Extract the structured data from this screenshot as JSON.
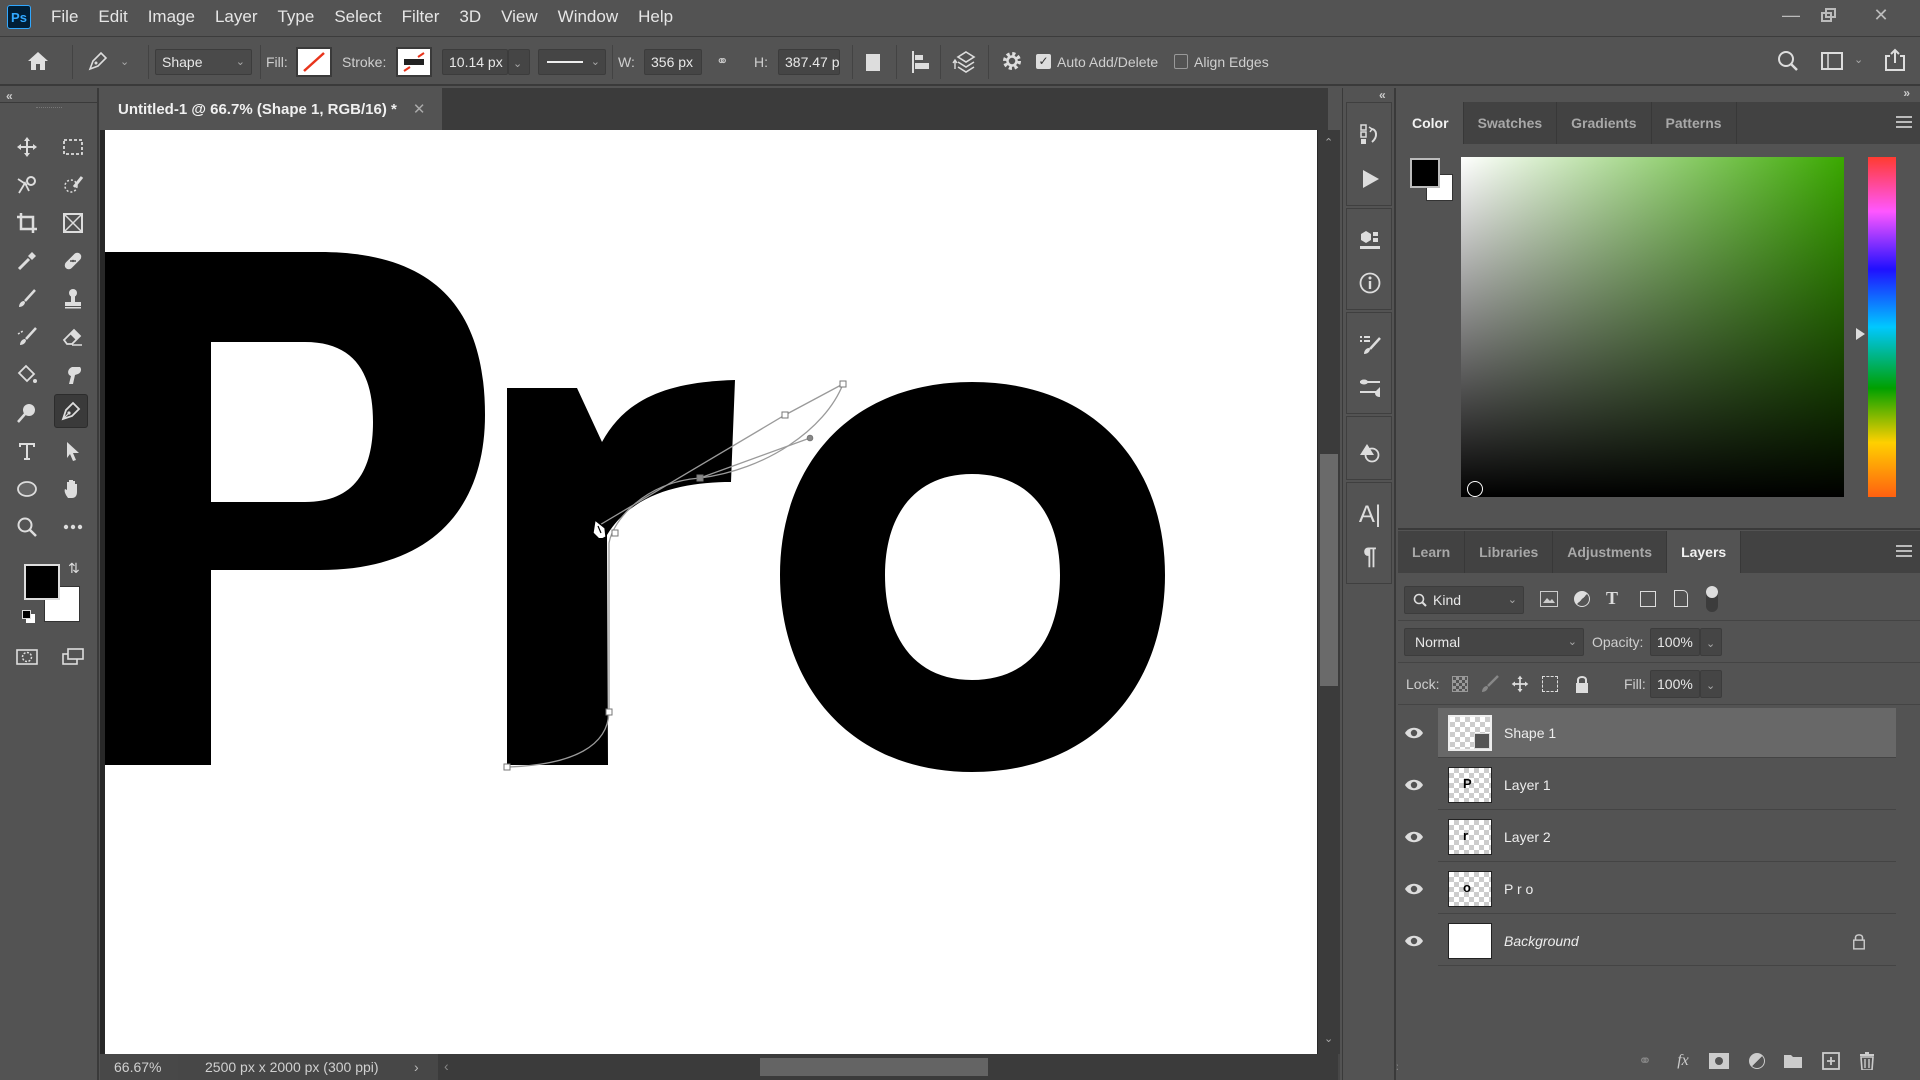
{
  "app": {
    "logo": "Ps"
  },
  "menubar": {
    "items": [
      "File",
      "Edit",
      "Image",
      "Layer",
      "Type",
      "Select",
      "Filter",
      "3D",
      "View",
      "Window",
      "Help"
    ]
  },
  "window_controls": [
    "minimize-icon",
    "restore-icon",
    "close-icon"
  ],
  "options_bar": {
    "tool_mode": "Shape",
    "fill_label": "Fill:",
    "stroke_label": "Stroke:",
    "stroke_width": "10.14 px",
    "w_label": "W:",
    "w_value": "356 px",
    "h_label": "H:",
    "h_value": "387.47 p",
    "auto_add_delete": {
      "label": "Auto Add/Delete",
      "checked": true
    },
    "align_edges": {
      "label": "Align Edges",
      "checked": false
    }
  },
  "document": {
    "tab_title": "Untitled-1 @ 66.7% (Shape 1, RGB/16) *",
    "canvas_text": "Pro",
    "zoom": "66.67%",
    "doc_info": "2500 px x 2000 px (300 ppi)"
  },
  "toolbar": {
    "tools": [
      "move",
      "rectangular-marquee",
      "object-selection",
      "quick-selection",
      "crop",
      "frame",
      "eyedropper",
      "healing-brush",
      "brush",
      "clone-stamp",
      "history-brush",
      "eraser",
      "paint-bucket",
      "smudge",
      "dodge",
      "pen",
      "type",
      "path-selection",
      "ellipse",
      "hand",
      "zoom",
      "more-tools"
    ],
    "active_tool": "pen",
    "foreground_color": "#000000",
    "background_color": "#ffffff"
  },
  "color_panel": {
    "tabs": [
      "Color",
      "Swatches",
      "Gradients",
      "Patterns"
    ],
    "active_tab": "Color",
    "hue_color": "#3aa800",
    "foreground_color": "#000000",
    "background_color": "#ffffff"
  },
  "layers_panel": {
    "tabs": [
      "Learn",
      "Libraries",
      "Adjustments",
      "Layers"
    ],
    "active_tab": "Layers",
    "filter_kind": "Kind",
    "blend_mode": "Normal",
    "opacity_label": "Opacity:",
    "opacity": "100%",
    "lock_label": "Lock:",
    "fill_label": "Fill:",
    "fill": "100%",
    "layers": [
      {
        "name": "Shape 1",
        "selected": true,
        "thumb_glyph": "",
        "italic": false,
        "locked": false
      },
      {
        "name": "Layer 1",
        "selected": false,
        "thumb_glyph": "P",
        "italic": false,
        "locked": false
      },
      {
        "name": "Layer 2",
        "selected": false,
        "thumb_glyph": "r",
        "italic": false,
        "locked": false
      },
      {
        "name": "P r o",
        "selected": false,
        "thumb_glyph": "o",
        "italic": false,
        "locked": false
      },
      {
        "name": "Background",
        "selected": false,
        "thumb_glyph": "",
        "italic": true,
        "locked": true
      }
    ]
  }
}
